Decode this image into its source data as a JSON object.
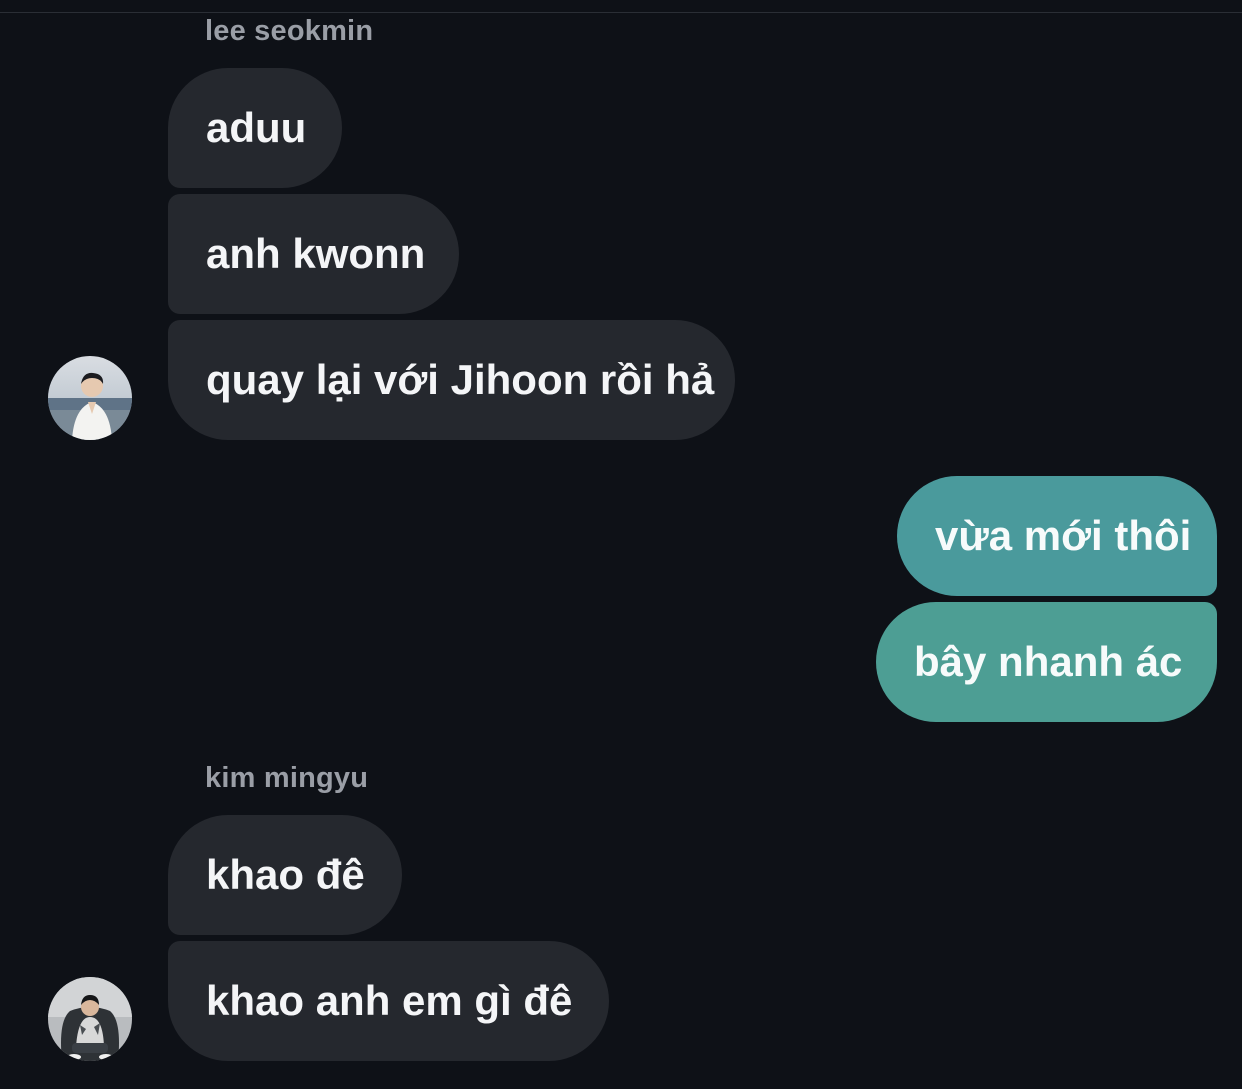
{
  "groups": [
    {
      "sender": "lee seokmin",
      "messages": [
        "aduu",
        "anh kwonn",
        "quay lại với Jihoon rồi hả"
      ],
      "avatar_icon": "user-avatar-photo-beach"
    },
    {
      "sender": "",
      "messages": [
        "vừa mới thôi",
        "bây nhanh ác"
      ],
      "outgoing": true
    },
    {
      "sender": "kim mingyu",
      "messages": [
        "khao đê",
        "khao anh em gì đê"
      ],
      "avatar_icon": "user-avatar-photo-seated"
    }
  ],
  "colors": {
    "background": "#0e1117",
    "incoming_bubble": "#25282e",
    "outgoing_bubble": "#4a9a9c",
    "sender_name": "#9a9ea6"
  }
}
